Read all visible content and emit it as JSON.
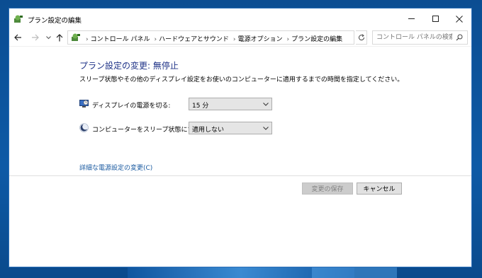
{
  "window": {
    "title": "プラン設定の編集"
  },
  "navigation": {
    "breadcrumbs": [
      "コントロール パネル",
      "ハードウェアとサウンド",
      "電源オプション",
      "プラン設定の編集"
    ],
    "search_placeholder": "コントロール パネルの検索"
  },
  "content": {
    "heading": "プラン設定の変更: 無停止",
    "description": "スリープ状態やその他のディスプレイ設定をお使いのコンピューターに適用するまでの時間を指定してください。",
    "settings": [
      {
        "label": "ディスプレイの電源を切る:",
        "value": "15 分",
        "icon": "monitor-icon"
      },
      {
        "label": "コンピューターをスリープ状態にする:",
        "value": "適用しない",
        "icon": "moon-icon"
      }
    ],
    "advanced_link": "詳細な電源設定の変更(C)"
  },
  "buttons": {
    "save": "変更の保存",
    "cancel": "キャンセル"
  },
  "colors": {
    "heading": "#1e3287",
    "link": "#1a5aa0",
    "window_border": "#2c6fb8"
  }
}
